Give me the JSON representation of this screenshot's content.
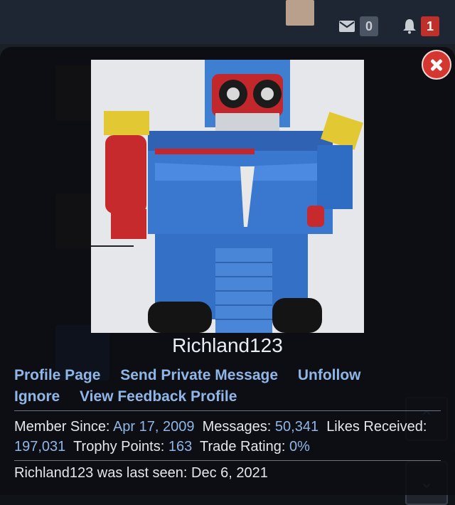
{
  "topbar": {
    "inbox_count": "0",
    "alerts_count": "1"
  },
  "profile": {
    "username": "Richland123",
    "links": {
      "profile_page": "Profile Page",
      "send_private_message": "Send Private Message",
      "unfollow": "Unfollow",
      "ignore": "Ignore",
      "view_feedback_profile": "View Feedback Profile"
    },
    "stats": {
      "member_since_label": "Member Since:",
      "member_since": "Apr 17, 2009",
      "messages_label": "Messages:",
      "messages": "50,341",
      "likes_label": "Likes Received:",
      "likes": "197,031",
      "trophy_label": "Trophy Points:",
      "trophy": "163",
      "trade_label": "Trade Rating:",
      "trade": "0%"
    },
    "last_seen": "Richland123 was last seen: Dec 6, 2021"
  },
  "icons": {
    "inbox": "envelope-icon",
    "alerts": "bell-icon",
    "close": "close-icon",
    "scroll_up": "chevron-up-icon",
    "scroll_down": "chevron-down-icon"
  },
  "colors": {
    "link": "#8fb6e6",
    "close": "#d43730",
    "alert_badge": "#c0302a"
  }
}
